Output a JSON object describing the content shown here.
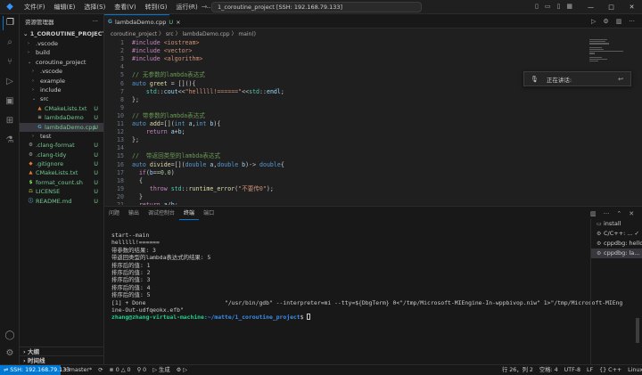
{
  "titlebar": {
    "menu": [
      "文件(F)",
      "编辑(E)",
      "选择(S)",
      "查看(V)",
      "转到(G)",
      "运行(R)",
      "..."
    ],
    "search": "1_coroutine_project [SSH: 192.168.79.133]",
    "window_controls": [
      "—",
      "□",
      "✕"
    ]
  },
  "sidebar": {
    "title": "资源管理器",
    "root": "1_COROUTINE_PROJECT [SSH: 192.168.79.133]",
    "items": [
      {
        "label": ".vscode",
        "type": "folder",
        "depth": 1,
        "open": false,
        "badge": ""
      },
      {
        "label": "build",
        "type": "folder",
        "depth": 1,
        "open": false,
        "badge": ""
      },
      {
        "label": "coroutine_project",
        "type": "folder",
        "depth": 1,
        "open": true,
        "badge": ""
      },
      {
        "label": ".vscode",
        "type": "folder",
        "depth": 2,
        "open": false,
        "badge": ""
      },
      {
        "label": "example",
        "type": "folder",
        "depth": 2,
        "open": false,
        "badge": ""
      },
      {
        "label": "include",
        "type": "folder",
        "depth": 2,
        "open": false,
        "badge": ""
      },
      {
        "label": "src",
        "type": "folder",
        "depth": 2,
        "open": true,
        "badge": ""
      },
      {
        "label": "CMakeLists.txt",
        "type": "cmake",
        "depth": 3,
        "badge": "U"
      },
      {
        "label": "lambdaDemo",
        "type": "file",
        "depth": 3,
        "badge": "U"
      },
      {
        "label": "lambdaDemo.cpp",
        "type": "cpp",
        "depth": 3,
        "badge": "U",
        "selected": true
      },
      {
        "label": "test",
        "type": "folder",
        "depth": 2,
        "open": false,
        "badge": ""
      },
      {
        "label": ".clang-format",
        "type": "config",
        "depth": 1,
        "badge": "U"
      },
      {
        "label": ".clang-tidy",
        "type": "config",
        "depth": 1,
        "badge": "U"
      },
      {
        "label": ".gitignore",
        "type": "git",
        "depth": 1,
        "badge": "U"
      },
      {
        "label": "CMakeLists.txt",
        "type": "cmake",
        "depth": 1,
        "badge": "U"
      },
      {
        "label": "format_count.sh",
        "type": "sh",
        "depth": 1,
        "badge": "U"
      },
      {
        "label": "LICENSE",
        "type": "license",
        "depth": 1,
        "badge": "U"
      },
      {
        "label": "README.md",
        "type": "md",
        "depth": 1,
        "badge": "U"
      }
    ],
    "outline": "大纲",
    "timeline": "时间线"
  },
  "editor": {
    "tab": {
      "label": "lambdaDemo.cpp",
      "badge": "U",
      "close": "×"
    },
    "breadcrumb": "coroutine_project 〉 src 〉 lambdaDemo.cpp 〉 main()",
    "lines": [
      {
        "n": "1",
        "tokens": [
          [
            "pp",
            "#include "
          ],
          [
            "inc",
            "<iostream>"
          ]
        ]
      },
      {
        "n": "2",
        "tokens": [
          [
            "pp",
            "#include "
          ],
          [
            "inc",
            "<vector>"
          ]
        ]
      },
      {
        "n": "3",
        "tokens": [
          [
            "pp",
            "#include "
          ],
          [
            "inc",
            "<algorithm>"
          ]
        ]
      },
      {
        "n": "4",
        "tokens": []
      },
      {
        "n": "5",
        "tokens": [
          [
            "cm",
            "// 无参数的lambda表达式"
          ]
        ]
      },
      {
        "n": "6",
        "tokens": [
          [
            "kw",
            "auto "
          ],
          [
            "fn",
            "greet"
          ],
          [
            "op",
            " = []()"
          ],
          [
            "op",
            "{"
          ]
        ]
      },
      {
        "n": "7",
        "tokens": [
          [
            "op",
            "    "
          ],
          [
            "ty",
            "std"
          ],
          [
            "op",
            "::"
          ],
          [
            "id",
            "cout"
          ],
          [
            "op",
            "<<"
          ],
          [
            "str",
            "\"helllll!======\""
          ],
          [
            "op",
            "<<"
          ],
          [
            "ty",
            "std"
          ],
          [
            "op",
            "::"
          ],
          [
            "id",
            "endl"
          ],
          [
            "op",
            ";"
          ]
        ]
      },
      {
        "n": "8",
        "tokens": [
          [
            "op",
            "};"
          ]
        ]
      },
      {
        "n": "9",
        "tokens": []
      },
      {
        "n": "10",
        "tokens": [
          [
            "cm",
            "// 带参数的lambda表达式"
          ]
        ]
      },
      {
        "n": "11",
        "tokens": [
          [
            "kw",
            "auto "
          ],
          [
            "fn",
            "add"
          ],
          [
            "op",
            "=[]("
          ],
          [
            "kw",
            "int "
          ],
          [
            "id",
            "a"
          ],
          [
            "op",
            ","
          ],
          [
            "kw",
            "int "
          ],
          [
            "id",
            "b"
          ],
          [
            "op",
            "){"
          ]
        ]
      },
      {
        "n": "12",
        "tokens": [
          [
            "op",
            "    "
          ],
          [
            "ctl",
            "return "
          ],
          [
            "id",
            "a"
          ],
          [
            "op",
            "+"
          ],
          [
            "id",
            "b"
          ],
          [
            "op",
            ";"
          ]
        ]
      },
      {
        "n": "13",
        "tokens": [
          [
            "op",
            "};"
          ]
        ]
      },
      {
        "n": "14",
        "tokens": []
      },
      {
        "n": "15",
        "tokens": [
          [
            "cm",
            "//  带返回类型的lambda表达式"
          ]
        ]
      },
      {
        "n": "16",
        "tokens": [
          [
            "kw",
            "auto "
          ],
          [
            "fn",
            "divide"
          ],
          [
            "op",
            "=[]("
          ],
          [
            "kw",
            "double "
          ],
          [
            "id",
            "a"
          ],
          [
            "op",
            ","
          ],
          [
            "kw",
            "double "
          ],
          [
            "id",
            "b"
          ],
          [
            "op",
            ")-> "
          ],
          [
            "kw",
            "double"
          ],
          [
            "op",
            "{"
          ]
        ]
      },
      {
        "n": "17",
        "tokens": [
          [
            "op",
            "  "
          ],
          [
            "ctl",
            "if"
          ],
          [
            "op",
            "("
          ],
          [
            "id",
            "b"
          ],
          [
            "op",
            "=="
          ],
          [
            "num",
            "0.0"
          ],
          [
            "op",
            ")"
          ]
        ]
      },
      {
        "n": "18",
        "tokens": [
          [
            "op",
            "  {"
          ]
        ]
      },
      {
        "n": "19",
        "tokens": [
          [
            "op",
            "     "
          ],
          [
            "ctl",
            "throw "
          ],
          [
            "ty",
            "std"
          ],
          [
            "op",
            "::"
          ],
          [
            "fn",
            "runtime_error"
          ],
          [
            "op",
            "("
          ],
          [
            "str",
            "\"不要传0\""
          ],
          [
            "op",
            ");"
          ]
        ]
      },
      {
        "n": "20",
        "tokens": [
          [
            "op",
            "  }"
          ]
        ]
      },
      {
        "n": "21",
        "tokens": [
          [
            "op",
            "  "
          ],
          [
            "ctl",
            "return "
          ],
          [
            "id",
            "a"
          ],
          [
            "op",
            "/"
          ],
          [
            "id",
            "b"
          ],
          [
            "op",
            ";"
          ]
        ]
      }
    ]
  },
  "voice": {
    "label": "正在讲话:"
  },
  "panel": {
    "tabs": [
      "问题",
      "输出",
      "调试控制台",
      "终端",
      "端口"
    ],
    "active_tab": 3,
    "terminal_lines": [
      "start--main",
      "helllll!======",
      "带参数的结果: 3",
      "带返回类型的lambda表达式的结果: 5",
      "排序后的值: 1",
      "排序后的值: 2",
      "排序后的值: 3",
      "排序后的值: 4",
      "排序后的值: 5",
      "[1] + Done                       \"/usr/bin/gdb\" --interpreter=mi --tty=${DbgTerm} 0<\"/tmp/Microsoft-MIEngine-In-wppbivop.niw\" 1>\"/tmp/Microsoft-MIEng",
      "ine-Out-udfqeokx.efb\""
    ],
    "prompt_user": "zhang@zhang-virtual-machine",
    "prompt_path": ":~/matte/1_coroutine_project",
    "prompt_end": "$ ",
    "terminals": [
      {
        "label": "install",
        "icon": "▭"
      },
      {
        "label": "C/C++: ...",
        "icon": "⚙",
        "check": "✓"
      },
      {
        "label": "cppdbg: hello",
        "icon": "⚙"
      },
      {
        "label": "cppdbg: la...",
        "icon": "⚙",
        "selected": true
      }
    ]
  },
  "statusbar": {
    "remote": "⇌ SSH: 192.168.79.133",
    "branch": "⑂ master*",
    "sync": "⟳",
    "errors": "⊗ 0 △ 0",
    "ports": "⚲ 0",
    "run": "▷ 生成",
    "tools": "⚙ ▷",
    "position": "行 26，列 2",
    "spaces": "空格: 4",
    "encoding": "UTF-8",
    "eol": "LF",
    "language": "{} C++",
    "os": "Linux",
    "bell": "🔔"
  }
}
